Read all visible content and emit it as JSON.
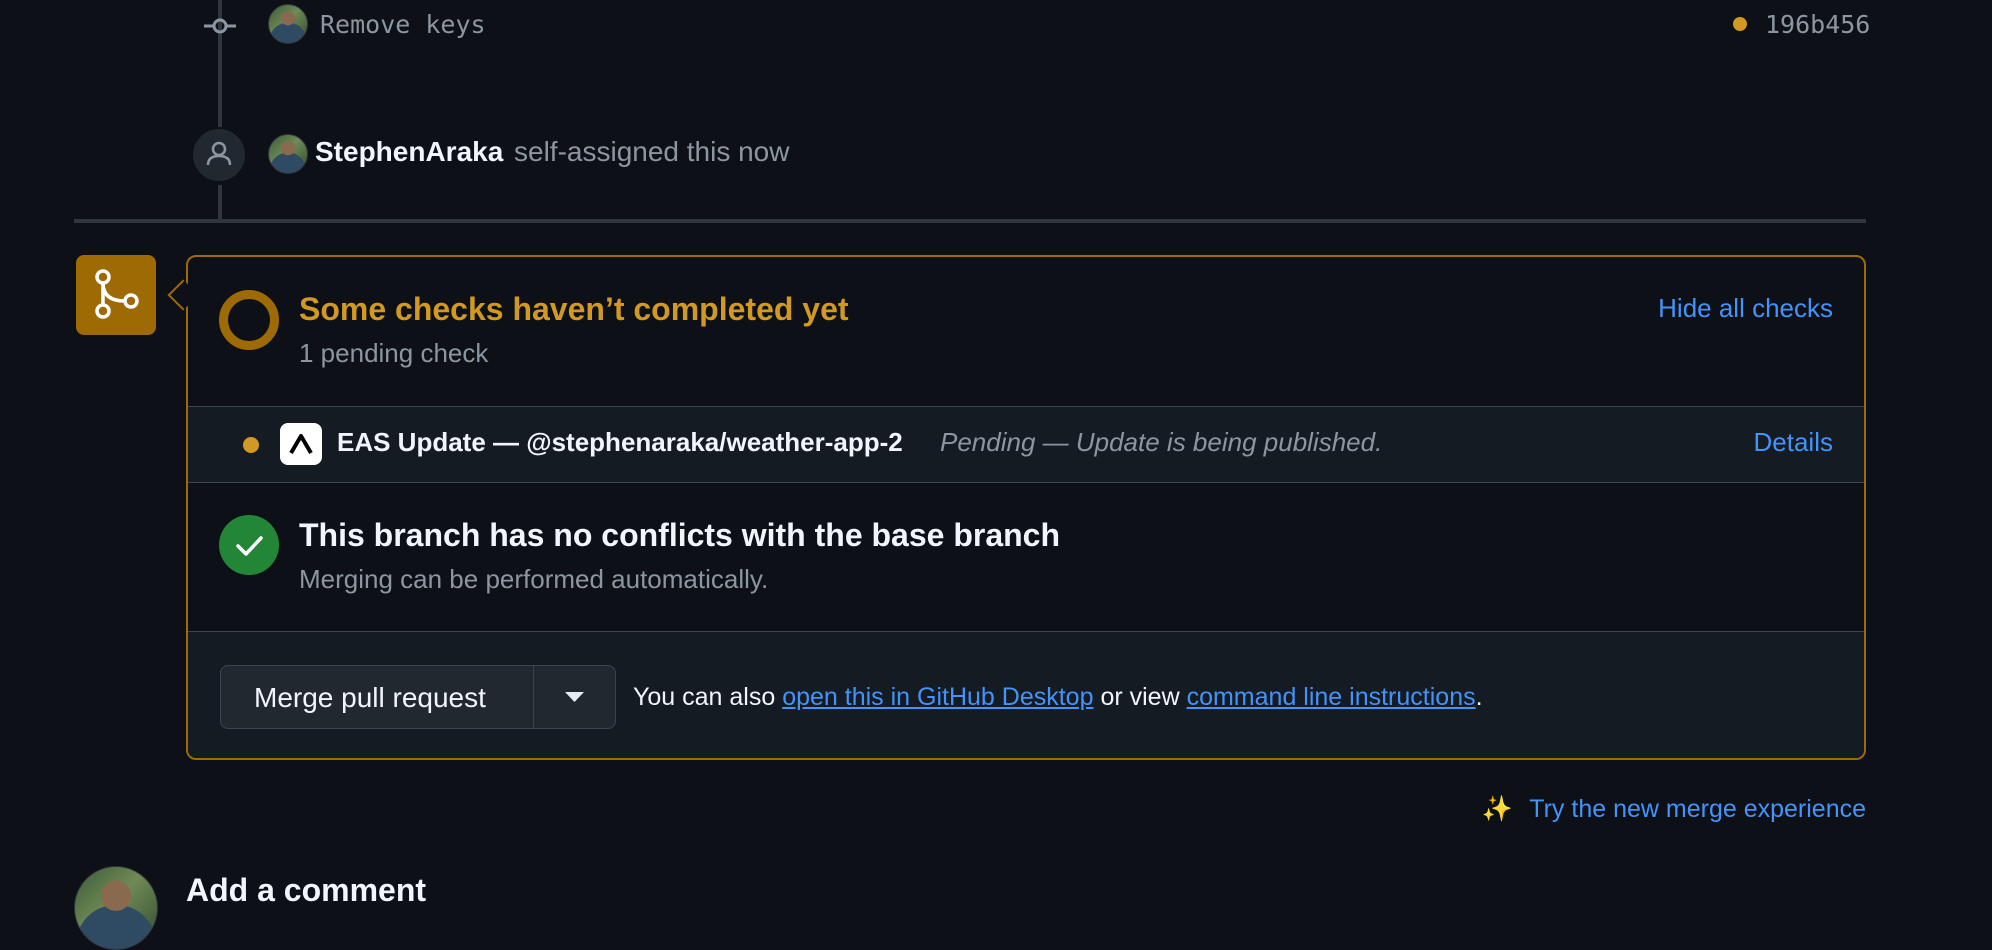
{
  "timeline": {
    "commit": {
      "message": "Remove keys",
      "sha": "196b456",
      "status_color": "#d29922"
    },
    "event": {
      "user": "StephenAraka",
      "action": "self-assigned this now"
    }
  },
  "checks": {
    "title": "Some checks haven’t completed yet",
    "subtitle": "1 pending check",
    "toggle_label": "Hide all checks",
    "items": [
      {
        "name": "EAS Update — @stephenaraka/weather-app-2",
        "status": "Pending — Update is being published.",
        "details_label": "Details"
      }
    ]
  },
  "conflicts": {
    "title": "This branch has no conflicts with the base branch",
    "subtitle": "Merging can be performed automatically."
  },
  "merge": {
    "button_label": "Merge pull request",
    "also_prefix": "You can also",
    "desktop_link": "open this in GitHub Desktop",
    "or_view": "or view",
    "cli_link": "command line instructions",
    "period": "."
  },
  "new_experience": {
    "sparkle": "✨",
    "label": "Try the new merge experience"
  },
  "comment": {
    "heading": "Add a comment"
  },
  "colors": {
    "pending": "#d29922",
    "success": "#238636",
    "link": "#4493f8",
    "merge_icon_bg": "#9e6a03"
  }
}
